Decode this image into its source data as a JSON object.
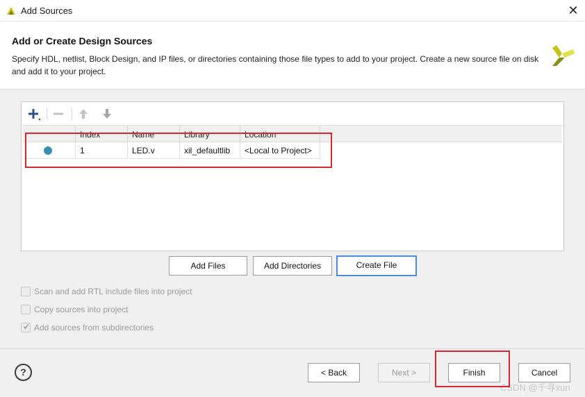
{
  "window": {
    "title": "Add Sources",
    "close_symbol": "✕"
  },
  "header": {
    "title": "Add or Create Design Sources",
    "description": "Specify HDL, netlist, Block Design, and IP files, or directories containing those file types to add to your project. Create a new source file on disk and add it to your project."
  },
  "toolbar": {
    "icons": [
      "add-icon",
      "remove-icon",
      "move-up-icon",
      "move-down-icon"
    ]
  },
  "table": {
    "columns": [
      "Index",
      "Name",
      "Library",
      "Location"
    ],
    "rows": [
      {
        "status_icon": "status-dot-icon",
        "index": "1",
        "name": "LED.v",
        "library": "xil_defaultlib",
        "location": "<Local to Project>"
      }
    ]
  },
  "buttons": {
    "add_files": "Add Files",
    "add_directories": "Add Directories",
    "create_file": "Create File"
  },
  "options": [
    {
      "label": "Scan and add RTL include files into project",
      "checked": false,
      "enabled": false
    },
    {
      "label": "Copy sources into project",
      "checked": false,
      "enabled": false
    },
    {
      "label": "Add sources from subdirectories",
      "checked": true,
      "enabled": false
    }
  ],
  "footer": {
    "help": "?",
    "back": "< Back",
    "next": "Next >",
    "finish": "Finish",
    "cancel": "Cancel",
    "watermark": "CSDN @千寻xun"
  },
  "colors": {
    "accent": "#4a8ae0",
    "highlight_box": "#d9262c",
    "status_dot": "#3b8fb0",
    "logo_yellow": "#c6c41a"
  }
}
